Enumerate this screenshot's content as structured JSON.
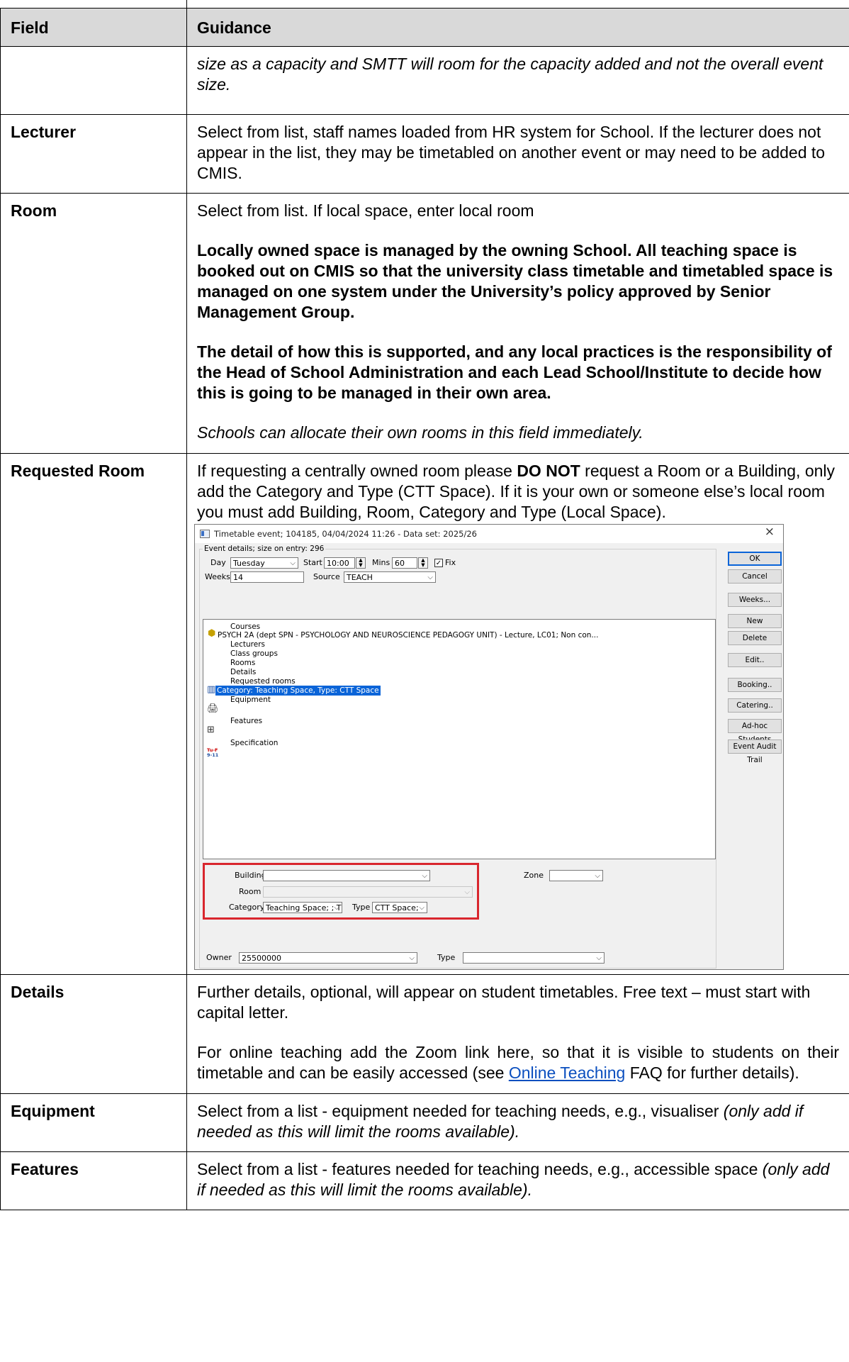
{
  "table": {
    "header": {
      "field": "Field",
      "guidance": "Guidance"
    },
    "rows": {
      "cont": {
        "field": "",
        "guidance_italic": "size as a capacity and SMTT will room for the capacity added and not the overall event size."
      },
      "lecturer": {
        "field": "Lecturer",
        "guidance": "Select from list, staff names loaded from HR system for School. If the lecturer does not appear in the list, they may be timetabled on another event or may need to be added to CMIS."
      },
      "room": {
        "field": "Room",
        "p1": "Select from list. If local space, enter local room",
        "p2": "Locally owned space is managed by the owning School. All teaching space is booked out on CMIS so that the university class timetable and timetabled space is managed on one system under the University’s policy approved by Senior Management Group.",
        "p3": "The detail of how this is supported, and any local practices is the responsibility of the Head of School Administration and each Lead School/Institute to decide how this is going to be managed in their own area.",
        "p4": "Schools can allocate their own rooms in this field immediately."
      },
      "requested_room": {
        "field": "Requested Room",
        "t1": "If requesting a centrally owned room please ",
        "t_bold": "DO NOT",
        "t2": " request a Room or a Building, only add the Category and Type (CTT Space). If it is your own or someone else’s local room you must add Building, Room, Category and Type (Local Space)."
      },
      "details": {
        "field": "Details",
        "p1": "Further details, optional, will appear on student timetables. Free text – must start with capital letter.",
        "p2a": "For online teaching add the Zoom link here, so that it is visible to students on their timetable and can be easily accessed (see ",
        "p2_link": "Online Teaching",
        "p2b": " FAQ for further details)."
      },
      "equipment": {
        "field": "Equipment",
        "t1": "Select from a list - equipment needed for teaching needs, e.g., visualiser ",
        "t_italic": "(only add if needed as this will limit the rooms available)."
      },
      "features": {
        "field": "Features",
        "t1": "Select from a list - features needed for teaching needs, e.g., accessible space ",
        "t_italic": "(only add if needed as this will limit the rooms available)."
      }
    }
  },
  "dialog": {
    "title": "Timetable event; 104185, 04/04/2024 11:26  -  Data set: 2025/26",
    "close": "×",
    "group_legend": "Event details; size on entry: 296",
    "day_label": "Day",
    "day_value": "Tuesday",
    "start_label": "Start",
    "start_value": "10:00",
    "mins_label": "Mins",
    "mins_value": "60",
    "fix_label": "Fix",
    "fix_checked": "✓",
    "weeks_label": "Weeks",
    "weeks_value": "14",
    "source_label": "Source",
    "source_value": "TEACH",
    "tree": {
      "courses": "Courses",
      "course_item": "PSYCH 2A (dept SPN - PSYCHOLOGY AND NEUROSCIENCE PEDAGOGY UNIT) - Lecture, LC01; Non con...",
      "lecturers": "Lecturers",
      "class_groups": "Class groups",
      "rooms": "Rooms",
      "details": "Details",
      "requested_rooms": "Requested rooms",
      "requested_item": "Category: Teaching Space, Type: CTT Space",
      "equipment": "Equipment",
      "features": "Features",
      "specification": "Specification",
      "spec_icon_top": "Tu-F",
      "spec_icon_bottom": "9-11"
    },
    "building_label": "Building",
    "building_value": "",
    "zone_label": "Zone",
    "zone_value": "",
    "room_label": "Room",
    "room_value": "",
    "category_label": "Category",
    "category_value": "Teaching Space; ; T",
    "type_label": "Type",
    "type_value": "CTT Space;",
    "owner_label": "Owner",
    "owner_value": "25500000",
    "owner_type_label": "Type",
    "owner_type_value": "",
    "buttons": {
      "ok": "OK",
      "cancel": "Cancel",
      "weeks": "Weeks...",
      "new": "New",
      "delete": "Delete",
      "edit": "Edit..",
      "booking": "Booking..",
      "catering": "Catering..",
      "adhoc": "Ad-hoc Students",
      "audit": "Event Audit Trail"
    },
    "accent_color": "#d9262d",
    "selection_color": "#0a64d8"
  }
}
